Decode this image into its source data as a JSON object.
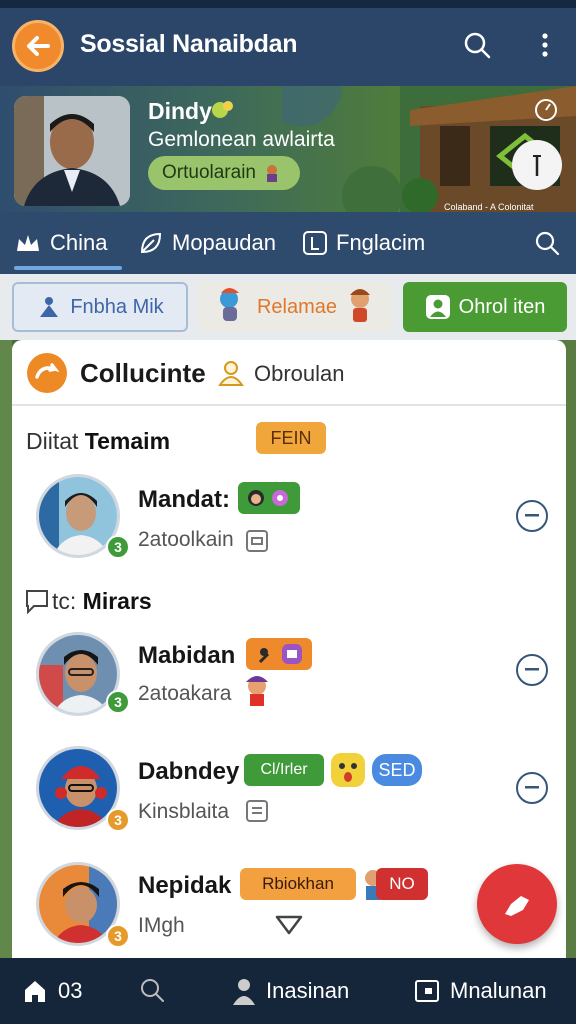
{
  "header": {
    "title": "Sossial Nanaibdan"
  },
  "profile": {
    "name": "Dindy",
    "subtitle": "Gemlonean awlairta",
    "pill": "Ortuolarain",
    "credit": "Colaband - A Colonitat"
  },
  "tabs": [
    {
      "label": "China"
    },
    {
      "label": "Mopaudan"
    },
    {
      "label": "Fnglacim"
    }
  ],
  "actions": {
    "primary": "Fnbha Mik",
    "secondary": "Relamae",
    "tertiary": "Ohrol iten"
  },
  "card": {
    "title": "Collucinte",
    "subtitle": "Obroulan",
    "sections": [
      {
        "label_prefix": "Diitat ",
        "label_bold": "Temaim",
        "tag": "FEIN"
      },
      {
        "label_prefix": "tc: ",
        "label_bold": "Mirars"
      }
    ],
    "people": [
      {
        "name": "Mandat:",
        "sub": "2atoolkain",
        "badge": "3",
        "badge_color": "#3f9a3a"
      },
      {
        "name": "Mabidan",
        "sub": "2atoakara",
        "badge": "3",
        "badge_color": "#3f9a3a"
      },
      {
        "name": "Dabndey",
        "sub": "Kinsblaita",
        "badge": "3",
        "badge_color": "#e79a2c",
        "tags": [
          "Cl/Irler",
          "SED"
        ]
      },
      {
        "name": "Nepidak",
        "sub": "IMgh",
        "badge": "3",
        "badge_color": "#e79a2c",
        "tags": [
          "Rbiokhan",
          "NO"
        ]
      }
    ]
  },
  "bottom_nav": [
    {
      "label": "03"
    },
    {
      "label": "Inasinan"
    },
    {
      "label": "Mnalunan"
    }
  ],
  "colors": {
    "appbar": "#2b4668",
    "accent_orange": "#f08a2c",
    "accent_green": "#4b9b35",
    "fab": "#e0373a"
  }
}
